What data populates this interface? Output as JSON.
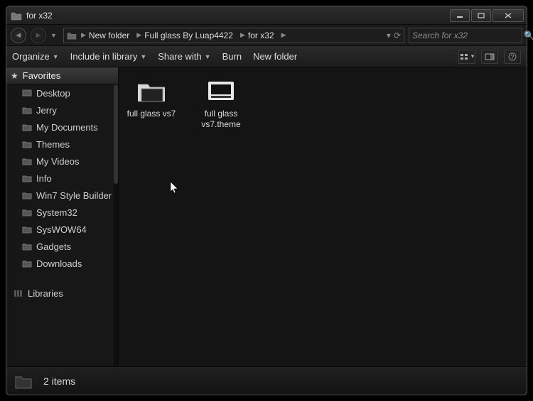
{
  "window": {
    "title": "for x32"
  },
  "breadcrumbs": [
    {
      "label": "New folder"
    },
    {
      "label": "Full glass By Luap4422"
    },
    {
      "label": "for x32"
    }
  ],
  "search": {
    "placeholder": "Search for x32"
  },
  "toolbar": {
    "organize": "Organize",
    "include": "Include in library",
    "share": "Share with",
    "burn": "Burn",
    "newfolder": "New folder"
  },
  "nav": {
    "favorites_label": "Favorites",
    "items": [
      {
        "label": "Desktop"
      },
      {
        "label": "Jerry"
      },
      {
        "label": "My Documents"
      },
      {
        "label": "Themes"
      },
      {
        "label": "My Videos"
      },
      {
        "label": "Info"
      },
      {
        "label": "Win7 Style Builder"
      },
      {
        "label": "System32"
      },
      {
        "label": "SysWOW64"
      },
      {
        "label": "Gadgets"
      },
      {
        "label": "Downloads"
      }
    ],
    "libraries_label": "Libraries"
  },
  "files": [
    {
      "label": "full glass vs7",
      "kind": "folder"
    },
    {
      "label": "full glass vs7.theme",
      "kind": "theme"
    }
  ],
  "status": {
    "text": "2 items"
  }
}
